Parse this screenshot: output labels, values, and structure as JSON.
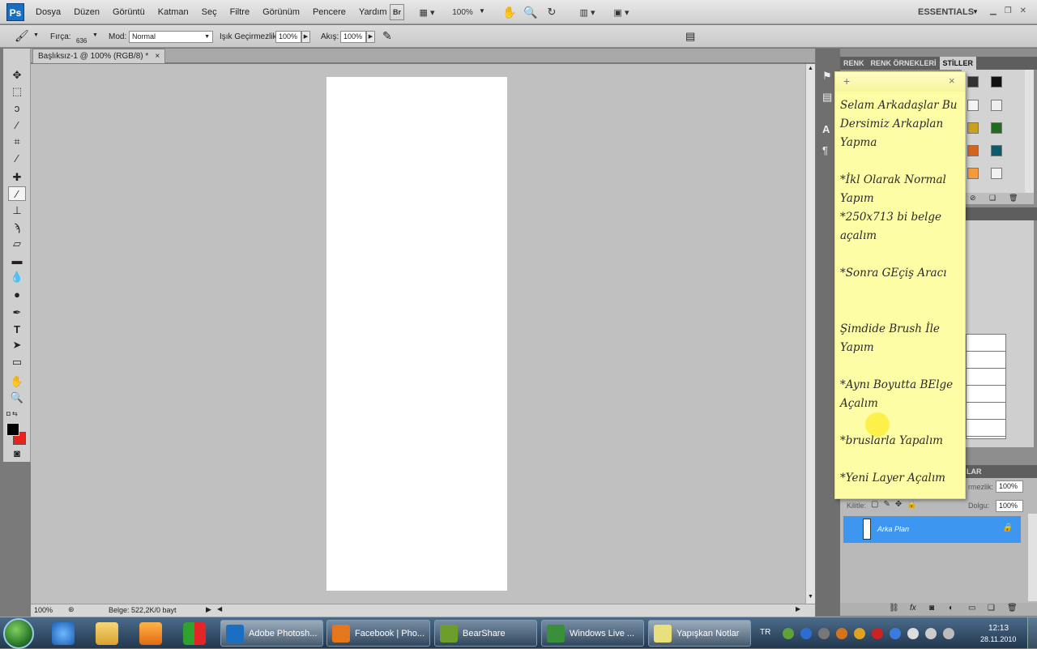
{
  "menubar": {
    "logo": "Ps",
    "menus": [
      "Dosya",
      "Düzen",
      "Görüntü",
      "Katman",
      "Seç",
      "Filtre",
      "Görünüm",
      "Pencere",
      "Yardım"
    ],
    "bridge": "Br",
    "zoom": "100%",
    "workspace": "ESSENTIALS"
  },
  "options": {
    "brush_label": "Fırça:",
    "brush_size": "636",
    "mode_label": "Mod:",
    "mode_value": "Normal",
    "opacity_label": "Işık Geçirmezlik:",
    "opacity_value": "100%",
    "flow_label": "Akış:",
    "flow_value": "100%"
  },
  "document": {
    "tab_title": "Başlıksız-1 @ 100% (RGB/8) *",
    "close": "×",
    "status_zoom": "100%",
    "status_info": "Belge: 522,2K/0 bayt"
  },
  "panels": {
    "tabs": [
      "RENK",
      "RENK ÖRNEKLERİ",
      "STİLLER"
    ],
    "active_tab": "STİLLER",
    "layers_tab": "LAR",
    "opacity_label": "rmezlik:",
    "opacity_value": "100%",
    "lock_label": "Kilitle:",
    "fill_label": "Dolgu:",
    "fill_value": "100%",
    "layer_name": "Arka Plan"
  },
  "sticky_note": {
    "add": "+",
    "close": "×",
    "text": "Selam Arkadaşlar Bu Dersimiz Arkaplan Yapma\n\n*İkl Olarak Normal Yapım\n*250x713 bi belge açalım\n\n*Sonra GEçiş Aracı\n\n\nŞimdide Brush İle Yapım\n\n*Aynı Boyutta BElge Açalım\n\n*bruslarla Yapalım\n\n*Yeni Layer Açalım"
  },
  "taskbar": {
    "tasks": [
      {
        "label": "Adobe Photosh...",
        "color": "#1b6fc2"
      },
      {
        "label": "Facebook | Pho...",
        "color": "#e6761b"
      },
      {
        "label": "BearShare",
        "color": "#6d9d2a"
      },
      {
        "label": "Windows Live ...",
        "color": "#3a8f3a"
      },
      {
        "label": "Yapışkan Notlar",
        "color": "#e8e07a"
      }
    ],
    "lang": "TR",
    "time": "12:13",
    "date": "28.11.2010"
  },
  "colors": {
    "foreground": "#000000",
    "background": "#e8231c",
    "layer_selected": "#3d97f0",
    "sticky": "#fdfda5"
  }
}
